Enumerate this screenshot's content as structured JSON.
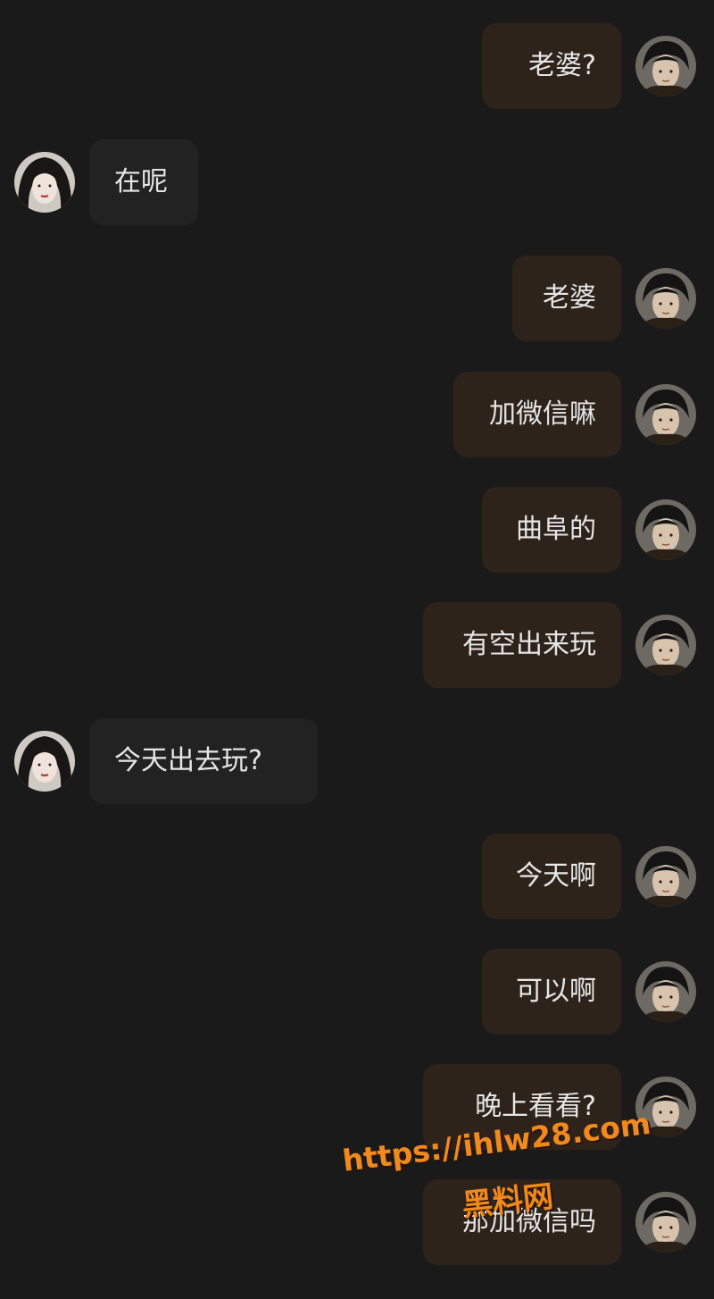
{
  "messages": [
    {
      "side": "out",
      "text": "老婆?"
    },
    {
      "side": "in",
      "text": "在呢"
    },
    {
      "side": "out",
      "text": "老婆"
    },
    {
      "side": "out",
      "text": "加微信嘛"
    },
    {
      "side": "out",
      "text": "曲阜的"
    },
    {
      "side": "out",
      "text": "有空出来玩"
    },
    {
      "side": "in",
      "text": "今天出去玩?"
    },
    {
      "side": "out",
      "text": "今天啊"
    },
    {
      "side": "out",
      "text": "可以啊"
    },
    {
      "side": "out",
      "text": "晚上看看?"
    },
    {
      "side": "out",
      "text": "那加微信吗"
    }
  ],
  "watermark": {
    "url": "https://ihlw28.com",
    "site_name": "黑料网"
  },
  "colors": {
    "background": "#1a1a1a",
    "outgoing_bubble": "#2d231b",
    "incoming_bubble": "#222222",
    "text": "#e6e6e6",
    "watermark": "#f08a1c"
  },
  "icons": {
    "outgoing_avatar": "male-avatar-icon",
    "incoming_avatar": "female-avatar-icon"
  }
}
